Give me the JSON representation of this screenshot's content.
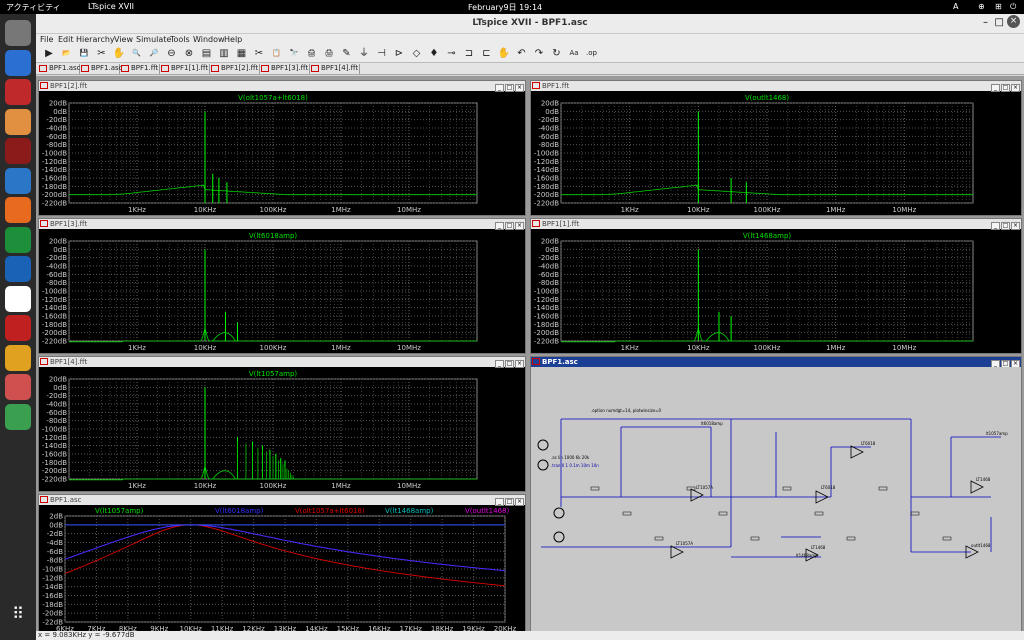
{
  "topbar": {
    "activities": "アクティビティ",
    "app": "LTspice XVII",
    "clock": "February9日  19:14",
    "lang": "A"
  },
  "dock": [
    "settings-icon",
    "text-editor-icon",
    "filezilla-icon",
    "files-icon",
    "ltspice-icon",
    "update-icon",
    "firefox-icon",
    "spreadsheet-icon",
    "kicad-icon",
    "maxima-icon",
    "game-icon",
    "chrome-icon",
    "package-icon",
    "trash-icon",
    "apps-grid-icon"
  ],
  "window": {
    "title": "LTspice XVII - BPF1.asc"
  },
  "menu": [
    "File",
    "Edit",
    "Hierarchy",
    "View",
    "Simulate",
    "Tools",
    "Window",
    "Help"
  ],
  "toolbar": [
    "▶",
    "📂",
    "💾",
    "✂",
    "✋",
    "🔍",
    "🔎",
    "⊖",
    "⊗",
    "▤",
    "▥",
    "▦",
    "✂",
    "📋",
    "🔭",
    "🖨",
    "🖨",
    "✎",
    "⏚",
    "⊣",
    "⊳",
    "◇",
    "♦",
    "⊸",
    "⊐",
    "⊏",
    "✋",
    "↶",
    "↷",
    "↻",
    "Aa",
    ".op"
  ],
  "tabs": [
    "BPF1.asc",
    "BPF1.asc",
    "BPF1.fft",
    "BPF1[1].fft",
    "BPF1[2].fft",
    "BPF1[3].fft",
    "BPF1[4].fft"
  ],
  "plots": [
    {
      "id": "p1",
      "title": "BPF1[2].fft",
      "trace": "V(olt1057a+lt6018)",
      "peaks": [
        [
          10000,
          0
        ],
        [
          13000,
          -150
        ],
        [
          16000,
          -160
        ],
        [
          21000,
          -170
        ]
      ],
      "skirt": "wide"
    },
    {
      "id": "p2",
      "title": "BPF1.fft",
      "trace": "V(outlt1468)",
      "peaks": [
        [
          10000,
          0
        ],
        [
          30000,
          -160
        ],
        [
          50000,
          -170
        ]
      ],
      "skirt": "wide"
    },
    {
      "id": "p3",
      "title": "BPF1[3].fft",
      "trace": "V(lt6018amp)",
      "peaks": [
        [
          10000,
          0
        ],
        [
          20000,
          -150
        ],
        [
          30000,
          -175
        ]
      ],
      "skirt": "narrow"
    },
    {
      "id": "p4",
      "title": "BPF1[1].fft",
      "trace": "V(lt1468amp)",
      "peaks": [
        [
          10000,
          0
        ],
        [
          20000,
          -150
        ],
        [
          30000,
          -160
        ]
      ],
      "skirt": "narrow"
    },
    {
      "id": "p5",
      "title": "BPF1[4].fft",
      "trace": "V(lt1057amp)",
      "peaks": [
        [
          10000,
          0
        ],
        [
          30000,
          -120
        ],
        [
          50000,
          -130
        ],
        [
          70000,
          -140
        ],
        [
          90000,
          -150
        ],
        [
          110000,
          -160
        ],
        [
          130000,
          -170
        ],
        [
          150000,
          -175
        ]
      ],
      "skirt": "comb"
    }
  ],
  "fft_axis": {
    "yticks": [
      "20dB",
      "0dB",
      "-20dB",
      "-40dB",
      "-60dB",
      "-80dB",
      "-100dB",
      "-120dB",
      "-140dB",
      "-160dB",
      "-180dB",
      "-200dB",
      "-220dB"
    ],
    "xticks": [
      "1KHz",
      "10KHz",
      "100KHz",
      "1MHz",
      "10MHz"
    ]
  },
  "ac_plot": {
    "title": "BPF1.asc",
    "legend": [
      {
        "name": "V(lt1057amp)",
        "color": "#00e000"
      },
      {
        "name": "V(lt6018amp)",
        "color": "#3030ff"
      },
      {
        "name": "V(olt1057a+lt6018)",
        "color": "#e00000"
      },
      {
        "name": "V(lt1468amp)",
        "color": "#00c0c0"
      },
      {
        "name": "V(outlt1468)",
        "color": "#e000e0"
      }
    ],
    "yticks": [
      "2dB",
      "0dB",
      "-2dB",
      "-4dB",
      "-6dB",
      "-8dB",
      "-10dB",
      "-12dB",
      "-14dB",
      "-16dB",
      "-18dB",
      "-20dB",
      "-22dB"
    ],
    "xticks": [
      "6KHz",
      "7KHz",
      "8KHz",
      "9KHz",
      "10KHz",
      "11KHz",
      "12KHz",
      "13KHz",
      "14KHz",
      "15KHz",
      "16KHz",
      "17KHz",
      "18KHz",
      "19KHz",
      "20KHz"
    ]
  },
  "schematic": {
    "title": "BPF1.asc",
    "directive1": ".option numdgt=14, plotwinsize=0",
    "directive2": ".ac lin 1000 6k 20k",
    "directive3": ".tran 0 1 0.1m 10m 10n",
    "labels": [
      "LT1057A",
      "LT1057A",
      "LT6018",
      "LT6018",
      "LT1468",
      "LT1468",
      "outlt1468",
      "lt6018amp",
      "lt1468amp",
      "lt1057amp"
    ]
  },
  "status": "x = 9.083KHz    y = -9.677dB"
}
